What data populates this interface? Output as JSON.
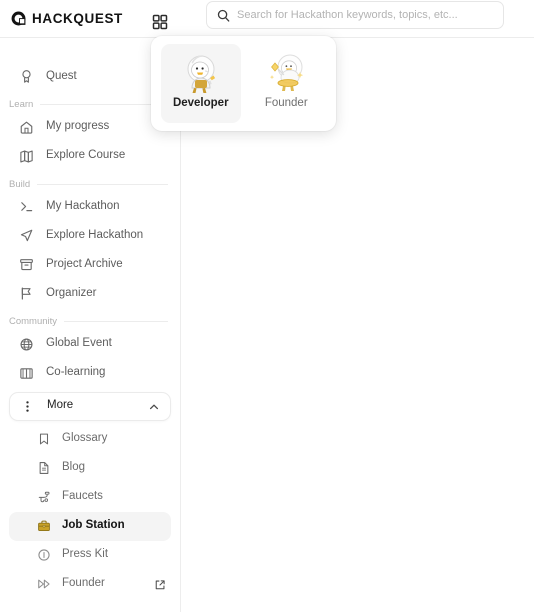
{
  "header": {
    "logo_text": "HACKQUEST",
    "logo_icon": "hackquest-logo-icon",
    "grid_icon": "apps-grid-icon",
    "search": {
      "icon": "search-icon",
      "placeholder": "Search for Hackathon keywords, topics, etc...",
      "value": ""
    }
  },
  "role_popover": {
    "options": [
      {
        "label": "Developer",
        "art": "astronaut-duck-developer",
        "selected": true
      },
      {
        "label": "Founder",
        "art": "astronaut-duck-founder",
        "selected": false
      }
    ]
  },
  "sidebar": {
    "top_items": [
      {
        "label": "Quest",
        "icon": "award-medal-icon"
      }
    ],
    "sections": [
      {
        "label": "Learn",
        "items": [
          {
            "label": "My progress",
            "icon": "home-icon"
          },
          {
            "label": "Explore Course",
            "icon": "map-icon"
          }
        ]
      },
      {
        "label": "Build",
        "items": [
          {
            "label": "My Hackathon",
            "icon": "terminal-icon"
          },
          {
            "label": "Explore Hackathon",
            "icon": "navigation-arrow-icon"
          },
          {
            "label": "Project Archive",
            "icon": "archive-box-icon"
          },
          {
            "label": "Organizer",
            "icon": "flag-icon"
          }
        ]
      },
      {
        "label": "Community",
        "items": [
          {
            "label": "Global Event",
            "icon": "globe-icon"
          },
          {
            "label": "Co-learning",
            "icon": "open-book-icon"
          }
        ]
      }
    ],
    "more": {
      "label": "More",
      "icon": "vertical-dots-icon",
      "chevron": "chevron-up-icon",
      "expanded": true,
      "items": [
        {
          "label": "Glossary",
          "icon": "bookmark-icon",
          "active": false,
          "external": false
        },
        {
          "label": "Blog",
          "icon": "document-icon",
          "active": false,
          "external": false
        },
        {
          "label": "Faucets",
          "icon": "faucet-icon",
          "active": false,
          "external": false
        },
        {
          "label": "Job Station",
          "icon": "briefcase-icon",
          "active": true,
          "external": false
        },
        {
          "label": "Press Kit",
          "icon": "info-circle-icon",
          "active": false,
          "external": false
        },
        {
          "label": "Founder",
          "icon": "fast-forward-icon",
          "active": false,
          "external": true,
          "external_icon": "external-link-icon"
        }
      ]
    }
  },
  "colors": {
    "accent_gold": "#c9a227",
    "active_bg": "#f4f4f4",
    "text_primary": "#141414",
    "text_muted": "#5c5c5c",
    "border": "#ececec"
  }
}
